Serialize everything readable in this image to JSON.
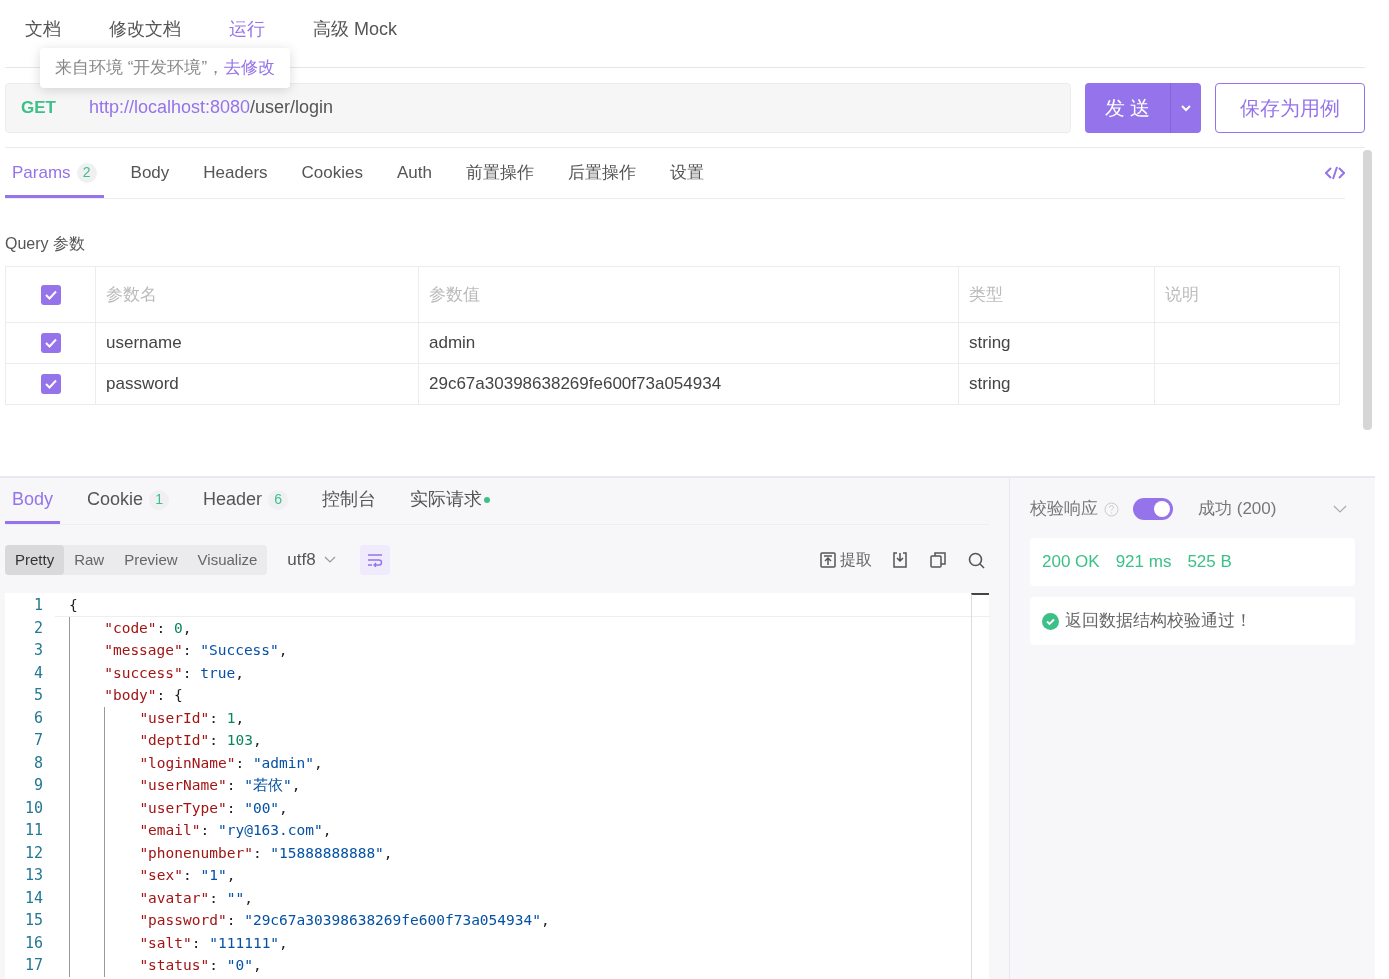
{
  "top_tabs": [
    {
      "label": "文档",
      "selected": false
    },
    {
      "label": "修改文档",
      "selected": false
    },
    {
      "label": "运行",
      "selected": true
    },
    {
      "label": "高级 Mock",
      "selected": false
    }
  ],
  "env_tooltip": {
    "text": "来自环境 “开发环境”，",
    "link": "去修改"
  },
  "request": {
    "method": "GET",
    "base_url": "http://localhost:8080",
    "path": "/user/login",
    "send": "发 送",
    "save": "保存为用例"
  },
  "request_tabs": [
    {
      "label": "Params",
      "count": "2",
      "selected": true
    },
    {
      "label": "Body",
      "selected": false
    },
    {
      "label": "Headers",
      "selected": false
    },
    {
      "label": "Cookies",
      "selected": false
    },
    {
      "label": "Auth",
      "selected": false
    },
    {
      "label": "前置操作",
      "selected": false
    },
    {
      "label": "后置操作",
      "selected": false
    },
    {
      "label": "设置",
      "selected": false
    }
  ],
  "query": {
    "title": "Query 参数",
    "header_checked": true,
    "columns": [
      "参数名",
      "参数值",
      "类型",
      "说明"
    ],
    "rows": [
      {
        "checked": true,
        "name": "username",
        "value": "admin",
        "type": "string"
      },
      {
        "checked": true,
        "name": "password",
        "value": "29c67a30398638269fe600f73a054934",
        "type": "string"
      }
    ]
  },
  "response_tabs": [
    {
      "label": "Body",
      "selected": true
    },
    {
      "label": "Cookie",
      "count": "1",
      "selected": false
    },
    {
      "label": "Header",
      "count": "6",
      "selected": false
    },
    {
      "label": "控制台",
      "selected": false
    },
    {
      "label": "实际请求",
      "dot": true,
      "selected": false
    }
  ],
  "view_modes": [
    {
      "label": "Pretty",
      "selected": true
    },
    {
      "label": "Raw",
      "selected": false
    },
    {
      "label": "Preview",
      "selected": false
    },
    {
      "label": "Visualize",
      "selected": false
    }
  ],
  "encoding": "utf8",
  "extract": "提取",
  "code": [
    {
      "number": "1",
      "tokens": [
        {
          "kind": "punct",
          "text": "{"
        }
      ],
      "children": [
        {
          "number": "2",
          "tokens": [
            {
              "kind": "key",
              "text": "\"code\""
            },
            {
              "kind": "punct",
              "text": ": "
            },
            {
              "kind": "number",
              "text": "0"
            },
            {
              "kind": "punct",
              "text": ","
            }
          ]
        },
        {
          "number": "3",
          "tokens": [
            {
              "kind": "key",
              "text": "\"message\""
            },
            {
              "kind": "punct",
              "text": ": "
            },
            {
              "kind": "string",
              "text": "\"Success\""
            },
            {
              "kind": "punct",
              "text": ","
            }
          ]
        },
        {
          "number": "4",
          "tokens": [
            {
              "kind": "key",
              "text": "\"success\""
            },
            {
              "kind": "punct",
              "text": ": "
            },
            {
              "kind": "bool",
              "text": "true"
            },
            {
              "kind": "punct",
              "text": ","
            }
          ]
        },
        {
          "number": "5",
          "tokens": [
            {
              "kind": "key",
              "text": "\"body\""
            },
            {
              "kind": "punct",
              "text": ": {"
            }
          ],
          "children": [
            {
              "number": "6",
              "tokens": [
                {
                  "kind": "key",
                  "text": "\"userId\""
                },
                {
                  "kind": "punct",
                  "text": ": "
                },
                {
                  "kind": "number",
                  "text": "1"
                },
                {
                  "kind": "punct",
                  "text": ","
                }
              ]
            },
            {
              "number": "7",
              "tokens": [
                {
                  "kind": "key",
                  "text": "\"deptId\""
                },
                {
                  "kind": "punct",
                  "text": ": "
                },
                {
                  "kind": "number",
                  "text": "103"
                },
                {
                  "kind": "punct",
                  "text": ","
                }
              ]
            },
            {
              "number": "8",
              "tokens": [
                {
                  "kind": "key",
                  "text": "\"loginName\""
                },
                {
                  "kind": "punct",
                  "text": ": "
                },
                {
                  "kind": "string",
                  "text": "\"admin\""
                },
                {
                  "kind": "punct",
                  "text": ","
                }
              ]
            },
            {
              "number": "9",
              "tokens": [
                {
                  "kind": "key",
                  "text": "\"userName\""
                },
                {
                  "kind": "punct",
                  "text": ": "
                },
                {
                  "kind": "string",
                  "text": "\"若依\""
                },
                {
                  "kind": "punct",
                  "text": ","
                }
              ]
            },
            {
              "number": "10",
              "tokens": [
                {
                  "kind": "key",
                  "text": "\"userType\""
                },
                {
                  "kind": "punct",
                  "text": ": "
                },
                {
                  "kind": "string",
                  "text": "\"00\""
                },
                {
                  "kind": "punct",
                  "text": ","
                }
              ]
            },
            {
              "number": "11",
              "tokens": [
                {
                  "kind": "key",
                  "text": "\"email\""
                },
                {
                  "kind": "punct",
                  "text": ": "
                },
                {
                  "kind": "string",
                  "text": "\"ry@163.com\""
                },
                {
                  "kind": "punct",
                  "text": ","
                }
              ]
            },
            {
              "number": "12",
              "tokens": [
                {
                  "kind": "key",
                  "text": "\"phonenumber\""
                },
                {
                  "kind": "punct",
                  "text": ": "
                },
                {
                  "kind": "string",
                  "text": "\"15888888888\""
                },
                {
                  "kind": "punct",
                  "text": ","
                }
              ]
            },
            {
              "number": "13",
              "tokens": [
                {
                  "kind": "key",
                  "text": "\"sex\""
                },
                {
                  "kind": "punct",
                  "text": ": "
                },
                {
                  "kind": "string",
                  "text": "\"1\""
                },
                {
                  "kind": "punct",
                  "text": ","
                }
              ]
            },
            {
              "number": "14",
              "tokens": [
                {
                  "kind": "key",
                  "text": "\"avatar\""
                },
                {
                  "kind": "punct",
                  "text": ": "
                },
                {
                  "kind": "string",
                  "text": "\"\""
                },
                {
                  "kind": "punct",
                  "text": ","
                }
              ]
            },
            {
              "number": "15",
              "tokens": [
                {
                  "kind": "key",
                  "text": "\"password\""
                },
                {
                  "kind": "punct",
                  "text": ": "
                },
                {
                  "kind": "string",
                  "text": "\"29c67a30398638269fe600f73a054934\""
                },
                {
                  "kind": "punct",
                  "text": ","
                }
              ]
            },
            {
              "number": "16",
              "tokens": [
                {
                  "kind": "key",
                  "text": "\"salt\""
                },
                {
                  "kind": "punct",
                  "text": ": "
                },
                {
                  "kind": "string",
                  "text": "\"111111\""
                },
                {
                  "kind": "punct",
                  "text": ","
                }
              ]
            },
            {
              "number": "17",
              "tokens": [
                {
                  "kind": "key",
                  "text": "\"status\""
                },
                {
                  "kind": "punct",
                  "text": ": "
                },
                {
                  "kind": "string",
                  "text": "\"0\""
                },
                {
                  "kind": "punct",
                  "text": ","
                }
              ]
            }
          ]
        }
      ]
    }
  ],
  "validation": {
    "label": "校验响应",
    "on": true,
    "result": "成功 (200)",
    "status": "200 OK",
    "time": "921 ms",
    "size": "525 B",
    "message": "返回数据结构校验通过！"
  }
}
